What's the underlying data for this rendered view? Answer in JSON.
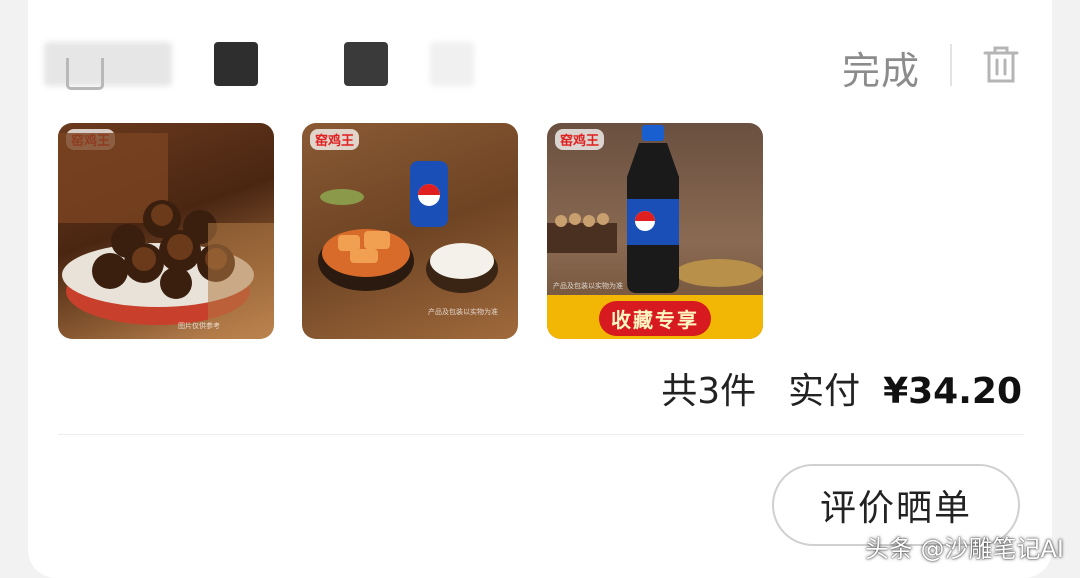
{
  "header": {
    "done_label": "完成",
    "delete_icon": "trash-icon"
  },
  "products": [
    {
      "brand": "窑鸡王",
      "fine_print": "图片仅供参考"
    },
    {
      "brand": "窑鸡王",
      "fine_print": "产品及包装以实物为准"
    },
    {
      "brand": "窑鸡王",
      "fine_print": "产品及包装以实物为准",
      "promo": "收藏专享"
    }
  ],
  "summary": {
    "count_text": "共3件",
    "paid_label": "实付",
    "amount": "¥34.20"
  },
  "actions": {
    "review_label": "评价晒单"
  },
  "watermark": {
    "text": "头条 @沙雕笔记AI"
  },
  "colors": {
    "accent_red": "#d71920",
    "promo_yellow": "#f2b705",
    "muted_text": "#8c8c8c"
  }
}
